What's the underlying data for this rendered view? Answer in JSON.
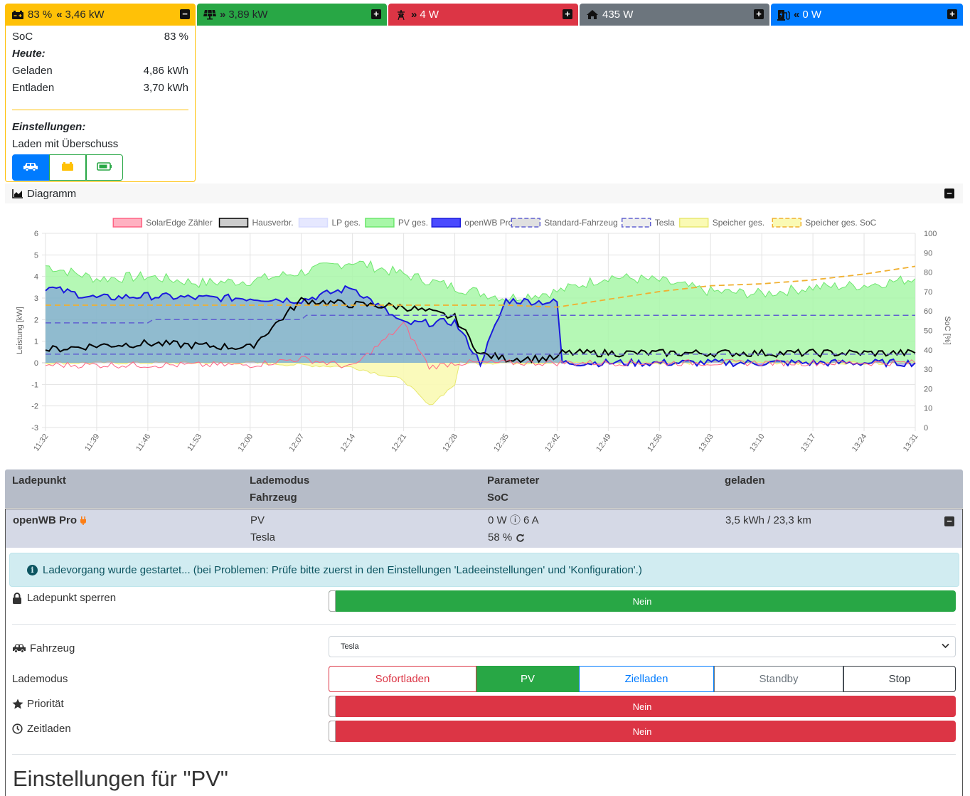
{
  "status_cards": {
    "battery": {
      "soc_text": "83 %",
      "power_text": "3,46 kW",
      "icon": "car-battery-icon",
      "direction_icon": "double-chevron-left-icon",
      "toggle": "−",
      "color": "#ffc107"
    },
    "pv": {
      "power_text": "3,89 kW",
      "icon": "solar-panel-icon",
      "direction_icon": "double-chevron-right-icon",
      "toggle": "+",
      "color": "#28a745"
    },
    "grid": {
      "power_text": "4 W",
      "icon": "power-tower-icon",
      "direction_icon": "double-chevron-right-icon",
      "toggle": "+",
      "color": "#dc3545"
    },
    "house": {
      "power_text": "435 W",
      "icon": "home-icon",
      "toggle": "+",
      "color": "#6c757d"
    },
    "chargepoint": {
      "power_text": "0 W",
      "icon": "charging-station-icon",
      "direction_icon": "double-chevron-left-icon",
      "toggle": "+",
      "color": "#007bff"
    }
  },
  "battery_details": {
    "soc_label": "SoC",
    "soc_value": "83 %",
    "today_heading": "Heute:",
    "charged_label": "Geladen",
    "charged_value": "4,86 kWh",
    "discharged_label": "Entladen",
    "discharged_value": "3,70 kWh",
    "settings_heading": "Einstellungen:",
    "mode_text": "Laden mit Überschuss",
    "priority_buttons": [
      "car-icon",
      "car-battery-icon",
      "battery-icon"
    ]
  },
  "diagram": {
    "title": "Diagramm",
    "toggle": "−"
  },
  "chart_data": {
    "type": "area",
    "legend": [
      {
        "name": "SolarEdge Zähler",
        "color": "#ff6384",
        "fill": "#ffb1c1",
        "dashed": false
      },
      {
        "name": "Hausverbr.",
        "color": "#000000",
        "fill": "#cccccc",
        "dashed": false
      },
      {
        "name": "LP ges.",
        "color": "#d8dcff",
        "fill": "#e6e8ff",
        "dashed": false
      },
      {
        "name": "PV ges.",
        "color": "#6ee76e",
        "fill": "#a8f7a8",
        "dashed": false
      },
      {
        "name": "openWB Pro",
        "color": "#1a1adc",
        "fill": "#4a4aff",
        "dashed": false
      },
      {
        "name": "Standard-Fahrzeug",
        "color": "#6060d0",
        "fill": "#e0e0e0",
        "dashed": true
      },
      {
        "name": "Tesla",
        "color": "#6060d0",
        "fill": "#eeeeee",
        "dashed": true
      },
      {
        "name": "Speicher ges.",
        "color": "#e8e870",
        "fill": "#fafab4",
        "dashed": false
      },
      {
        "name": "Speicher ges. SoC",
        "color": "#f0b030",
        "fill": "#fafab4",
        "dashed": true
      }
    ],
    "x_labels": [
      "11:32",
      "11:39",
      "11:46",
      "11:53",
      "12:00",
      "12:07",
      "12:14",
      "12:21",
      "12:28",
      "12:35",
      "12:42",
      "12:49",
      "12:56",
      "13:03",
      "13:10",
      "13:17",
      "13:24",
      "13:31"
    ],
    "ylabel": "Leistung [kW]",
    "ylim": [
      -3,
      6
    ],
    "y_ticks": [
      "6",
      "5",
      "4",
      "3",
      "2",
      "1",
      "0",
      "-1",
      "-2",
      "-3"
    ],
    "y2label": "SoC [%]",
    "y2lim": [
      0,
      100
    ],
    "y2_ticks": [
      "100",
      "90",
      "80",
      "70",
      "60",
      "50",
      "40",
      "30",
      "20",
      "10",
      "0"
    ],
    "grid": true,
    "legend_position": "top",
    "series": [
      {
        "name": "PV ges.",
        "axis": "y",
        "points": [
          [
            0,
            4.5
          ],
          [
            1,
            3.9
          ],
          [
            2,
            4.0
          ],
          [
            3,
            3.7
          ],
          [
            4,
            3.8
          ],
          [
            5,
            4.2
          ],
          [
            6,
            4.7
          ],
          [
            7,
            4.1
          ],
          [
            8,
            3.5
          ],
          [
            9,
            3.0
          ],
          [
            10,
            3.3
          ],
          [
            11,
            4.0
          ],
          [
            12,
            3.8
          ],
          [
            13,
            3.3
          ],
          [
            14,
            3.2
          ],
          [
            15,
            3.5
          ],
          [
            16,
            3.6
          ],
          [
            17,
            3.9
          ]
        ]
      },
      {
        "name": "Hausverbr.",
        "axis": "y",
        "points": [
          [
            0,
            0.6
          ],
          [
            1,
            0.8
          ],
          [
            2,
            0.9
          ],
          [
            3,
            0.8
          ],
          [
            4,
            0.7
          ],
          [
            5,
            2.9
          ],
          [
            6,
            2.7
          ],
          [
            7,
            2.6
          ],
          [
            8,
            2.1
          ],
          [
            8.5,
            0.4
          ],
          [
            9,
            0.2
          ],
          [
            10,
            0.2
          ],
          [
            10.1,
            0.45
          ],
          [
            11,
            0.45
          ],
          [
            12,
            0.45
          ],
          [
            13,
            0.45
          ],
          [
            14,
            0.45
          ],
          [
            15,
            0.45
          ],
          [
            16,
            0.45
          ],
          [
            17,
            0.45
          ]
        ]
      },
      {
        "name": "openWB Pro",
        "axis": "y",
        "points": [
          [
            0,
            3.5
          ],
          [
            1,
            3.0
          ],
          [
            2,
            3.1
          ],
          [
            3,
            3.0
          ],
          [
            4,
            3.0
          ],
          [
            5,
            2.9
          ],
          [
            6,
            3.5
          ],
          [
            7,
            1.8
          ],
          [
            8,
            1.9
          ],
          [
            8.5,
            0.0
          ],
          [
            9,
            2.9
          ],
          [
            10,
            2.8
          ],
          [
            10.1,
            0.0
          ],
          [
            17,
            0.0
          ]
        ]
      },
      {
        "name": "Speicher ges.",
        "axis": "y",
        "points": [
          [
            0,
            0.0
          ],
          [
            4,
            0.0
          ],
          [
            6,
            -0.2
          ],
          [
            7,
            -0.8
          ],
          [
            7.5,
            -2.0
          ],
          [
            8,
            -1.0
          ],
          [
            8.1,
            0.0
          ],
          [
            17,
            0.0
          ]
        ]
      },
      {
        "name": "SolarEdge Zähler",
        "axis": "y",
        "points": [
          [
            0,
            -0.1
          ],
          [
            4,
            -0.1
          ],
          [
            5,
            0.2
          ],
          [
            6,
            -0.2
          ],
          [
            7,
            1.8
          ],
          [
            7.5,
            -0.2
          ],
          [
            8,
            0.0
          ],
          [
            17,
            0.0
          ]
        ]
      },
      {
        "name": "Standard-Fahrzeug",
        "axis": "y",
        "points": [
          [
            0,
            1.85
          ],
          [
            2,
            1.85
          ],
          [
            2.1,
            2.0
          ],
          [
            5,
            2.0
          ],
          [
            5.1,
            2.2
          ],
          [
            8,
            2.2
          ],
          [
            9,
            2.2
          ],
          [
            10,
            2.2
          ],
          [
            10.1,
            2.2
          ],
          [
            17,
            2.2
          ]
        ]
      },
      {
        "name": "Tesla",
        "axis": "y",
        "points": [
          [
            0,
            0.4
          ],
          [
            8,
            0.4
          ],
          [
            9,
            0.4
          ],
          [
            10,
            0.4
          ],
          [
            17,
            0.4
          ]
        ]
      },
      {
        "name": "Speicher ges. SoC",
        "axis": "y2",
        "points": [
          [
            0,
            63
          ],
          [
            5,
            63
          ],
          [
            9,
            63
          ],
          [
            10,
            62
          ],
          [
            11,
            66
          ],
          [
            12,
            70
          ],
          [
            13,
            73
          ],
          [
            14,
            74
          ],
          [
            15,
            76
          ],
          [
            16,
            79
          ],
          [
            17,
            83
          ]
        ]
      }
    ]
  },
  "table": {
    "headers": {
      "col1": "Ladepunkt",
      "col2a": "Lademodus",
      "col2b": "Fahrzeug",
      "col3a": "Parameter",
      "col3b": "SoC",
      "col4": "geladen"
    },
    "row": {
      "name": "openWB Pro",
      "mode": "PV",
      "vehicle": "Tesla",
      "param": "0 W ⓘ 6 A",
      "soc": "58 %",
      "charged": "3,5 kWh / 23,3 km",
      "toggle": "−"
    }
  },
  "detail": {
    "alert_text": "Ladevorgang wurde gestartet... (bei Problemen: Prüfe bitte zuerst in den Einstellungen 'Ladeeinstellungen' und 'Konfiguration'.)",
    "lock_label": "Ladepunkt sperren",
    "lock_value": "Nein",
    "vehicle_label": "Fahrzeug",
    "vehicle_selected": "Tesla",
    "mode_label": "Lademodus",
    "modes": [
      "Sofortladen",
      "PV",
      "Zielladen",
      "Standby",
      "Stop"
    ],
    "active_mode": "PV",
    "priority_label": "Priorität",
    "priority_value": "Nein",
    "timecharge_label": "Zeitladen",
    "timecharge_value": "Nein",
    "settings_title": "Einstellungen für \"PV\""
  }
}
